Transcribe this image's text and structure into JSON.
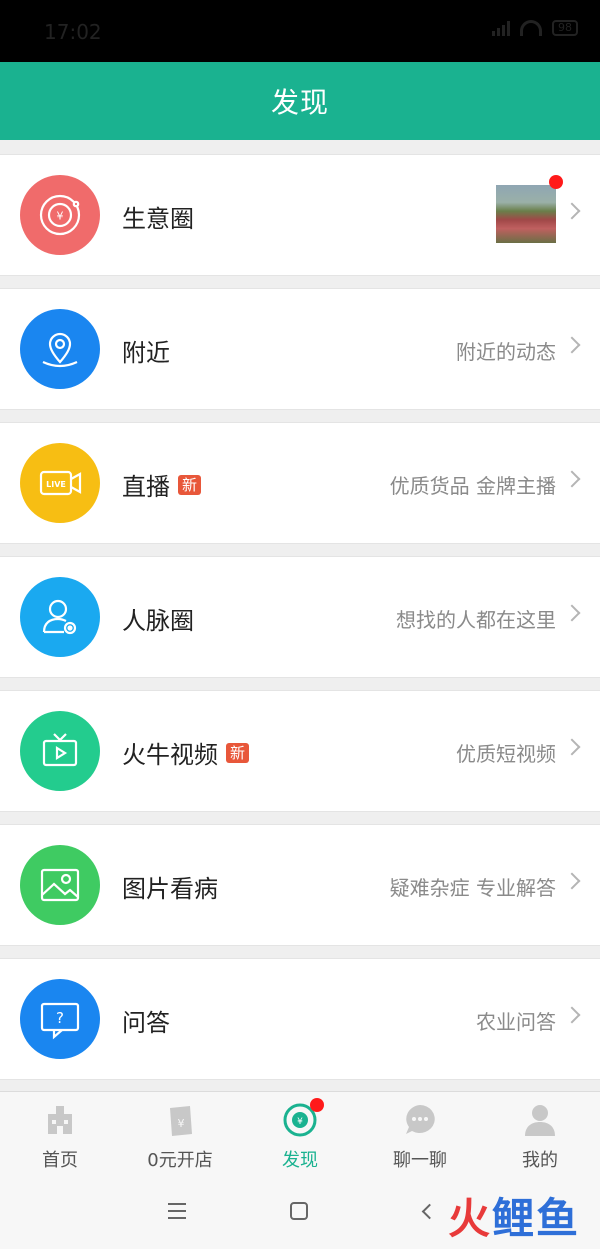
{
  "status_bar": {
    "time": "17:02",
    "battery": "98"
  },
  "header": {
    "title": "发现"
  },
  "rows": [
    {
      "label": "生意圈",
      "desc": "",
      "new_badge": false,
      "icon": "money-circle-icon",
      "color": "#f06b6b",
      "has_thumbnail": true,
      "has_dot": true
    },
    {
      "label": "附近",
      "desc": "附近的动态",
      "new_badge": false,
      "icon": "location-pin-icon",
      "color": "#1a86f0"
    },
    {
      "label": "直播",
      "desc": "优质货品 金牌主播",
      "new_badge": true,
      "icon": "live-camera-icon",
      "color": "#f7be13"
    },
    {
      "label": "人脉圈",
      "desc": "想找的人都在这里",
      "new_badge": false,
      "icon": "person-icon",
      "color": "#1aa9f0"
    },
    {
      "label": "火牛视频",
      "desc": "优质短视频",
      "new_badge": true,
      "icon": "tv-play-icon",
      "color": "#23cc8e"
    },
    {
      "label": "图片看病",
      "desc": "疑难杂症 专业解答",
      "new_badge": false,
      "icon": "image-icon",
      "color": "#3fcb62"
    },
    {
      "label": "问答",
      "desc": "农业问答",
      "new_badge": false,
      "icon": "question-chat-icon",
      "color": "#1a86f0"
    }
  ],
  "badges": {
    "new_label": "新"
  },
  "tabs": [
    {
      "label": "首页",
      "icon": "home-icon"
    },
    {
      "label": "0元开店",
      "icon": "shop-icon"
    },
    {
      "label": "发现",
      "icon": "discover-icon",
      "active": true,
      "has_dot": true
    },
    {
      "label": "聊一聊",
      "icon": "chat-icon"
    },
    {
      "label": "我的",
      "icon": "profile-icon"
    }
  ],
  "watermark": {
    "part1": "火",
    "part2": "鲤鱼"
  }
}
